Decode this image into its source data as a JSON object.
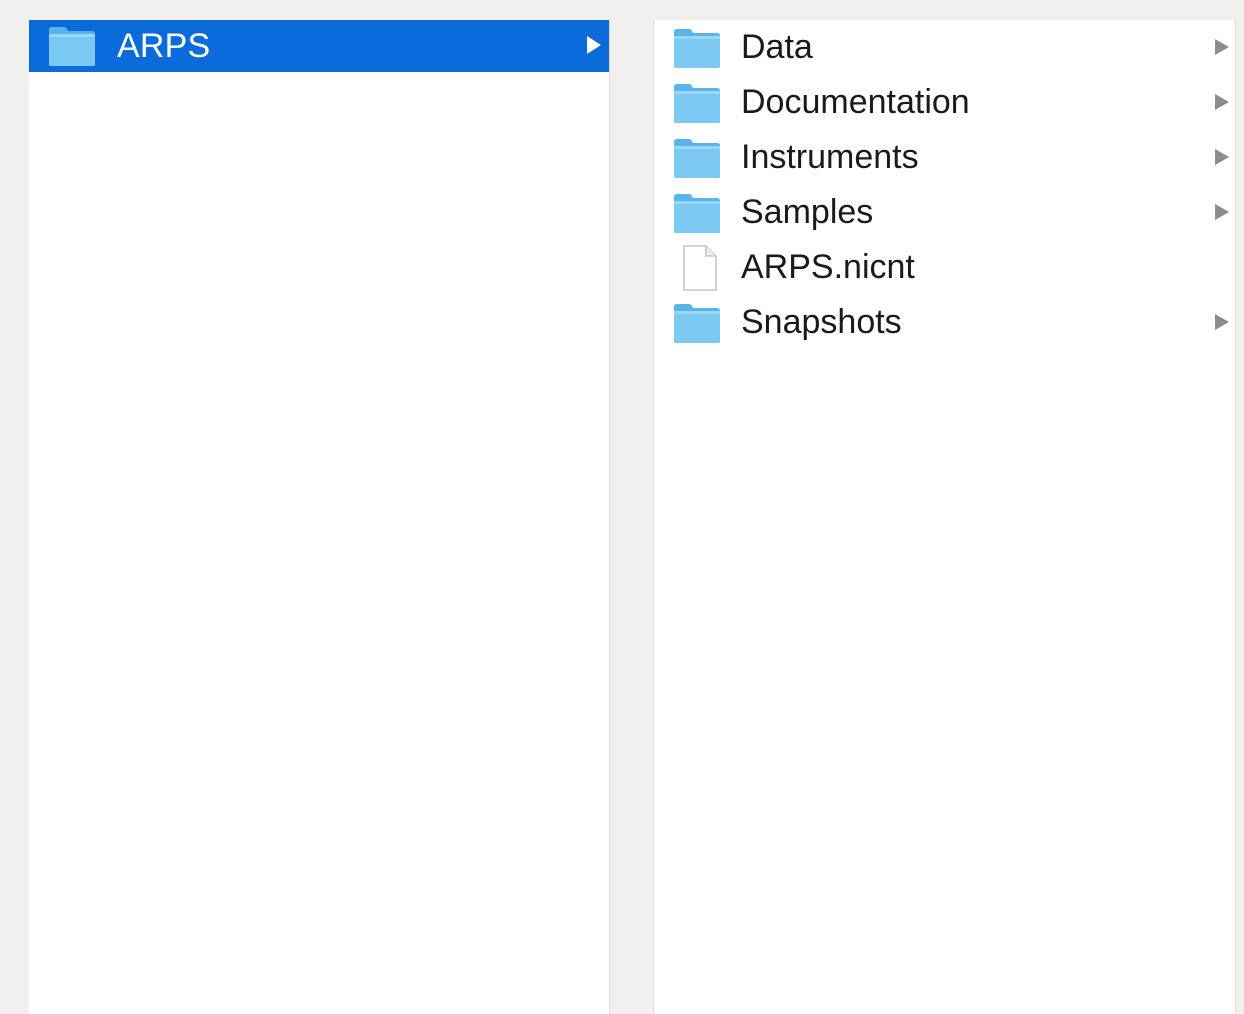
{
  "window": {
    "background": "#f1f0ef"
  },
  "columns": [
    {
      "items": [
        {
          "label": "ARPS",
          "kind": "folder",
          "icon": "folder-icon",
          "selected": true,
          "has_children": true
        }
      ]
    },
    {
      "items": [
        {
          "label": "Data",
          "kind": "folder",
          "icon": "folder-icon",
          "has_children": true
        },
        {
          "label": "Documentation",
          "kind": "folder",
          "icon": "folder-icon",
          "has_children": true
        },
        {
          "label": "Instruments",
          "kind": "folder",
          "icon": "folder-icon",
          "has_children": true
        },
        {
          "label": "Samples",
          "kind": "folder",
          "icon": "folder-icon",
          "has_children": true
        },
        {
          "label": "ARPS.nicnt",
          "kind": "file",
          "icon": "file-icon",
          "has_children": false
        },
        {
          "label": "Snapshots",
          "kind": "folder",
          "icon": "folder-icon",
          "has_children": true
        }
      ]
    }
  ],
  "colors": {
    "selection": "#0b6bdb",
    "folder_fill": "#6cc3f1",
    "folder_tab": "#5ab5ea",
    "text": "#1a1a1a",
    "chevron": "#8c8c8c"
  }
}
